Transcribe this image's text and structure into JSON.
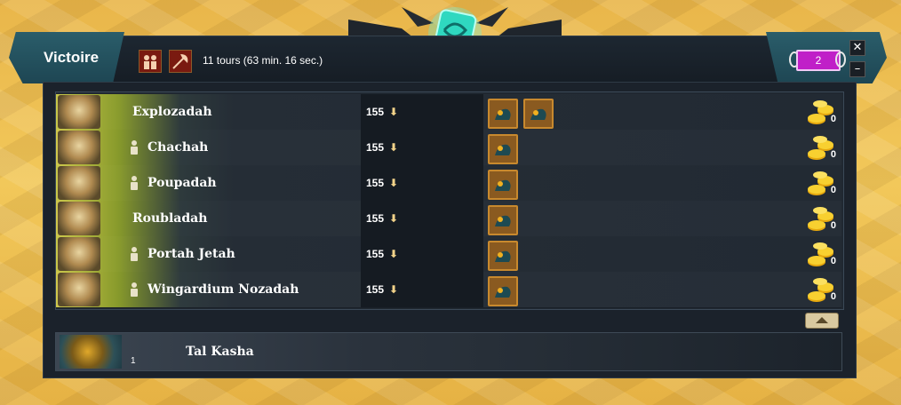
{
  "header": {
    "title": "Victoire",
    "turns_text": "11 tours (63 min. 16 sec.)",
    "counter": "2",
    "close_label": "✕",
    "minimize_label": "–"
  },
  "players": [
    {
      "name": "Explozadah",
      "level": "155",
      "ally": false,
      "items": 2,
      "gold": "0"
    },
    {
      "name": "Chachah",
      "level": "155",
      "ally": true,
      "items": 1,
      "gold": "0"
    },
    {
      "name": "Poupadah",
      "level": "155",
      "ally": true,
      "items": 1,
      "gold": "0"
    },
    {
      "name": "Roubladah",
      "level": "155",
      "ally": false,
      "items": 1,
      "gold": "0"
    },
    {
      "name": "Portah Jetah",
      "level": "155",
      "ally": true,
      "items": 1,
      "gold": "0"
    },
    {
      "name": "Wingardium Nozadah",
      "level": "155",
      "ally": true,
      "items": 1,
      "gold": "0"
    }
  ],
  "loser": {
    "name": "Tal Kasha",
    "number": "1"
  },
  "colors": {
    "accent": "#2a5d6a",
    "counter": "#c01fc8",
    "gold": "#f5c518"
  }
}
